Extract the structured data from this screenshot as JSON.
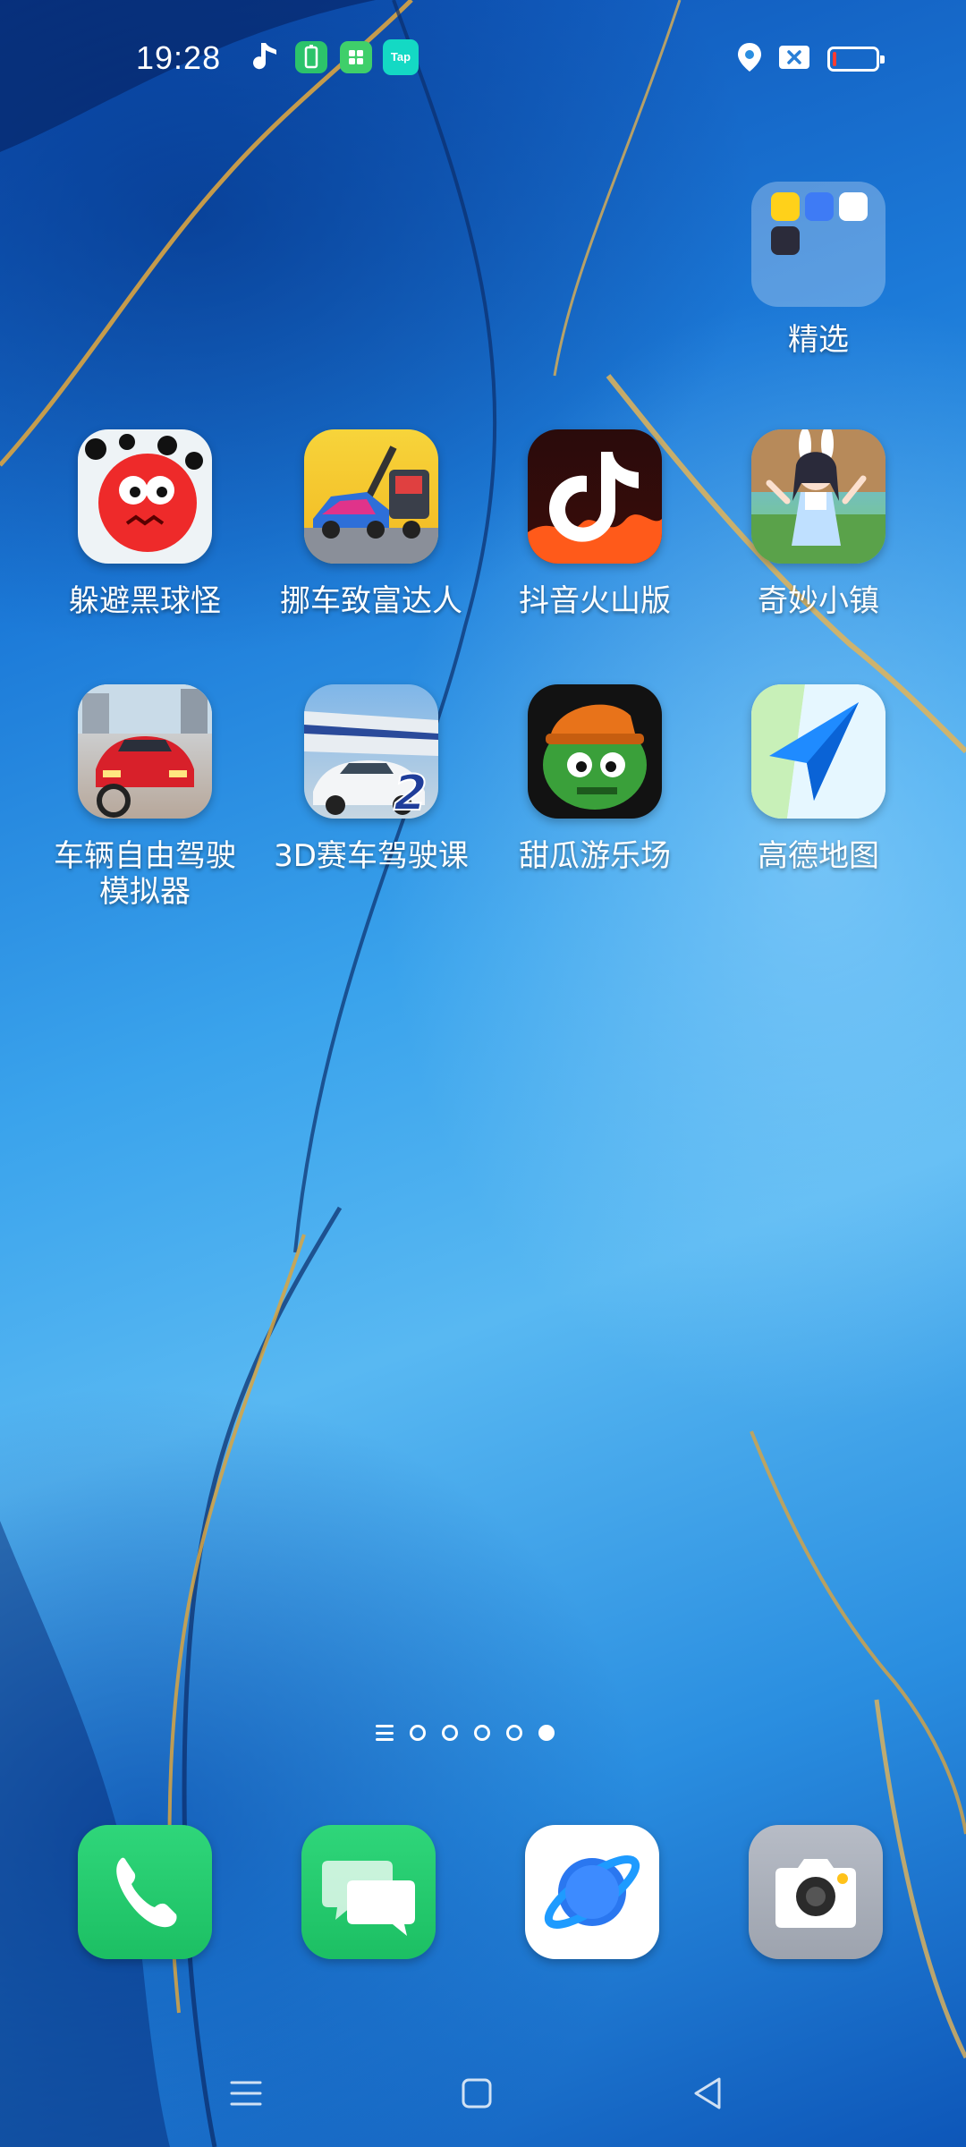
{
  "status_bar": {
    "time": "19:28",
    "left_icons": [
      "music-note-icon",
      "battery-saver-app-icon",
      "wechat-mini-icon",
      "taptap-icon"
    ],
    "taptap_text": "Tap",
    "right_icons": [
      "location-icon",
      "no-sim-icon",
      "battery-icon"
    ],
    "battery_level": 0.08
  },
  "folder": {
    "label": "精选",
    "mini_icons": [
      "yellow-app-icon",
      "blue-app-icon",
      "heart-app-icon",
      "purple-app-icon"
    ]
  },
  "apps": [
    {
      "label": "躲避黑球怪",
      "icon": "red-ball-game-icon"
    },
    {
      "label": "挪车致富达人",
      "icon": "tow-truck-game-icon"
    },
    {
      "label": "抖音火山版",
      "icon": "douyin-huoshan-icon"
    },
    {
      "label": "奇妙小镇",
      "icon": "anime-girl-game-icon"
    },
    {
      "label": "车辆自由驾驶模拟器",
      "label_line1": "车辆自由驾驶",
      "label_line2": "模拟器",
      "icon": "car-driving-sim-icon"
    },
    {
      "label": "3D赛车驾驶课",
      "icon": "racing-school-icon"
    },
    {
      "label": "甜瓜游乐场",
      "icon": "melon-playground-icon"
    },
    {
      "label": "高德地图",
      "icon": "amap-icon"
    }
  ],
  "page_indicator": {
    "total": 5,
    "active": 5
  },
  "dock": [
    {
      "name": "phone",
      "icon": "phone-icon"
    },
    {
      "name": "messages",
      "icon": "messages-icon"
    },
    {
      "name": "browser",
      "icon": "browser-icon"
    },
    {
      "name": "camera",
      "icon": "camera-icon"
    }
  ],
  "nav_bar": {
    "buttons": [
      "menu-icon",
      "home-icon",
      "back-icon"
    ]
  }
}
